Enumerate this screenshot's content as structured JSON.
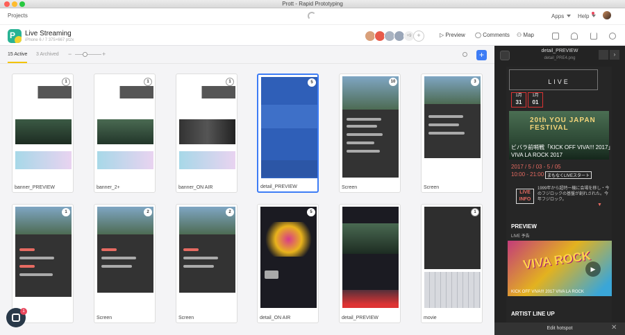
{
  "window": {
    "title": "Prott - Rapid Prototyping"
  },
  "topnav": {
    "projects": "Projects",
    "apps": "Apps",
    "help": "Help"
  },
  "project": {
    "name": "Live Streaming",
    "sub": "iPhone 6 / 7   375×667 pt2x"
  },
  "collaborators": {
    "count": "+9"
  },
  "header": {
    "preview": "Preview",
    "comments": "Comments",
    "map": "Map"
  },
  "toolbar": {
    "active_tab": "15 Active",
    "archived_tab": "3 Archived",
    "zoom_minus": "−",
    "zoom_plus": "+",
    "add": "+"
  },
  "cards": [
    {
      "name": "banner_PREVIEW",
      "badge": "1"
    },
    {
      "name": "banner_2+",
      "badge": "1"
    },
    {
      "name": "banner_ON AIR",
      "badge": "1"
    },
    {
      "name": "detail_PREVIEW",
      "badge": "5"
    },
    {
      "name": "Screen",
      "badge": "10"
    },
    {
      "name": "Screen",
      "badge": "3"
    },
    {
      "name": "n",
      "badge": "1"
    },
    {
      "name": "Screen",
      "badge": "2"
    },
    {
      "name": "Screen",
      "badge": "2"
    },
    {
      "name": "detail_ON AIR",
      "badge": "5"
    },
    {
      "name": "detail_PREVIEW",
      "badge": ""
    },
    {
      "name": "movie",
      "badge": "1"
    }
  ],
  "panel": {
    "title": "detail_PREVIEW",
    "file": "detail_PRE4.png",
    "live": "LIVE",
    "date1": {
      "m": "1月",
      "d": "31"
    },
    "date2": {
      "m": "1月",
      "d": "01"
    },
    "fest": "20th YOU JAPAN FESTIVAL",
    "headline": "ビバラ前哨戦「KICK OFF VIVA!!! 2017」VIVA LA ROCK 2017",
    "date_range": "2017 / 5 / 03 - 5 / 05",
    "time": "10:00 - 21:00",
    "time_badge": "まもなくLIVEスタート",
    "live_info": "LIVE INFO",
    "desc": "1999年から超特ー機に会場を移し・今のフジロックの基盤が創れされた。今年フジロック。",
    "preview": "PREVIEW",
    "preview_sub": "LIVE 予告",
    "video_title": "VIVA ROCK",
    "caption": "KICK OFF VIVA!!! 2017 VIVA LA ROCK",
    "artist": "ARTIST LINE UP",
    "edit": "Edit hotspot"
  },
  "chat": {
    "badge": "1"
  },
  "colors": {
    "accent": "#3d7cf5",
    "tab": "#f2c300",
    "red": "#e76b62",
    "panel": "#232323"
  }
}
